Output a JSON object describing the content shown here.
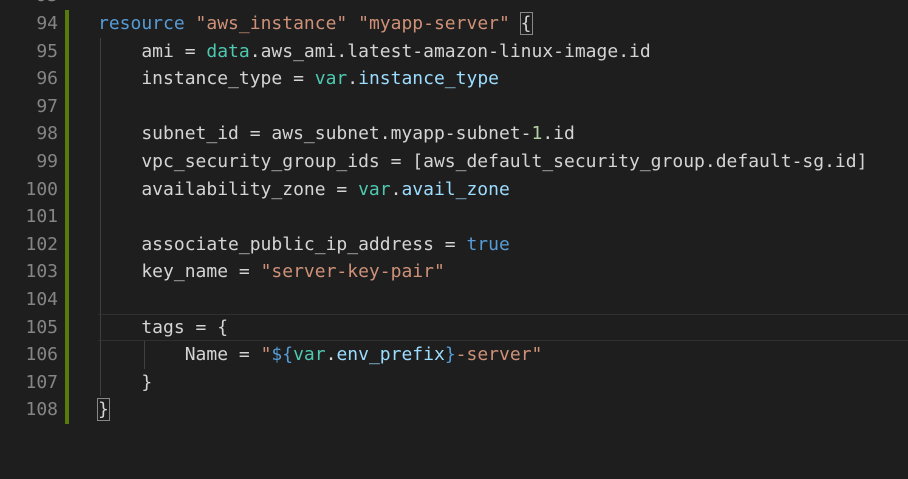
{
  "editor": {
    "colors": {
      "background": "#1e1e1e",
      "line_number": "#858585",
      "gutter_modified": "#587c0c",
      "keyword": "#569cd6",
      "string": "#ce9178",
      "identifier": "#d4d4d4",
      "variable": "#4ec9b0",
      "property": "#9cdcfe",
      "number": "#b5cea8"
    },
    "partial_top_line_number": "93",
    "lines": [
      {
        "number": "94",
        "tokens": [
          {
            "t": "resource",
            "c": "kw"
          },
          {
            "t": " ",
            "c": "punc"
          },
          {
            "t": "\"aws_instance\"",
            "c": "str"
          },
          {
            "t": " ",
            "c": "punc"
          },
          {
            "t": "\"myapp-server\"",
            "c": "str"
          },
          {
            "t": " ",
            "c": "punc"
          },
          {
            "t": "{",
            "c": "punc",
            "box": true
          }
        ]
      },
      {
        "number": "95",
        "tokens": [
          {
            "t": "    ami = ",
            "c": "ident"
          },
          {
            "t": "data",
            "c": "var"
          },
          {
            "t": ".aws_ami.latest-amazon-linux-image.id",
            "c": "ident"
          }
        ]
      },
      {
        "number": "96",
        "tokens": [
          {
            "t": "    instance_type = ",
            "c": "ident"
          },
          {
            "t": "var",
            "c": "var"
          },
          {
            "t": ".",
            "c": "ident"
          },
          {
            "t": "instance_type",
            "c": "prop"
          }
        ]
      },
      {
        "number": "97",
        "tokens": []
      },
      {
        "number": "98",
        "tokens": [
          {
            "t": "    subnet_id = aws_subnet.myapp-subnet-",
            "c": "ident"
          },
          {
            "t": "1",
            "c": "num"
          },
          {
            "t": ".id",
            "c": "ident"
          }
        ]
      },
      {
        "number": "99",
        "tokens": [
          {
            "t": "    vpc_security_group_ids = [aws_default_security_group.default-sg.id]",
            "c": "ident"
          }
        ]
      },
      {
        "number": "100",
        "tokens": [
          {
            "t": "    availability_zone = ",
            "c": "ident"
          },
          {
            "t": "var",
            "c": "var"
          },
          {
            "t": ".",
            "c": "ident"
          },
          {
            "t": "avail_zone",
            "c": "prop"
          }
        ]
      },
      {
        "number": "101",
        "tokens": []
      },
      {
        "number": "102",
        "tokens": [
          {
            "t": "    associate_public_ip_address = ",
            "c": "ident"
          },
          {
            "t": "true",
            "c": "kw"
          }
        ]
      },
      {
        "number": "103",
        "tokens": [
          {
            "t": "    key_name = ",
            "c": "ident"
          },
          {
            "t": "\"server-key-pair\"",
            "c": "str"
          }
        ]
      },
      {
        "number": "104",
        "tokens": []
      },
      {
        "number": "105",
        "tokens": [
          {
            "t": "    tags = {",
            "c": "ident"
          }
        ]
      },
      {
        "number": "106",
        "tokens": [
          {
            "t": "        Name = ",
            "c": "ident"
          },
          {
            "t": "\"",
            "c": "str"
          },
          {
            "t": "${",
            "c": "interp"
          },
          {
            "t": "var",
            "c": "var"
          },
          {
            "t": ".",
            "c": "ident"
          },
          {
            "t": "env_prefix",
            "c": "prop"
          },
          {
            "t": "}",
            "c": "interp"
          },
          {
            "t": "-server\"",
            "c": "str"
          }
        ]
      },
      {
        "number": "107",
        "tokens": [
          {
            "t": "    }",
            "c": "ident"
          }
        ]
      },
      {
        "number": "108",
        "tokens": [
          {
            "t": "}",
            "c": "punc",
            "box": true
          }
        ]
      }
    ]
  }
}
